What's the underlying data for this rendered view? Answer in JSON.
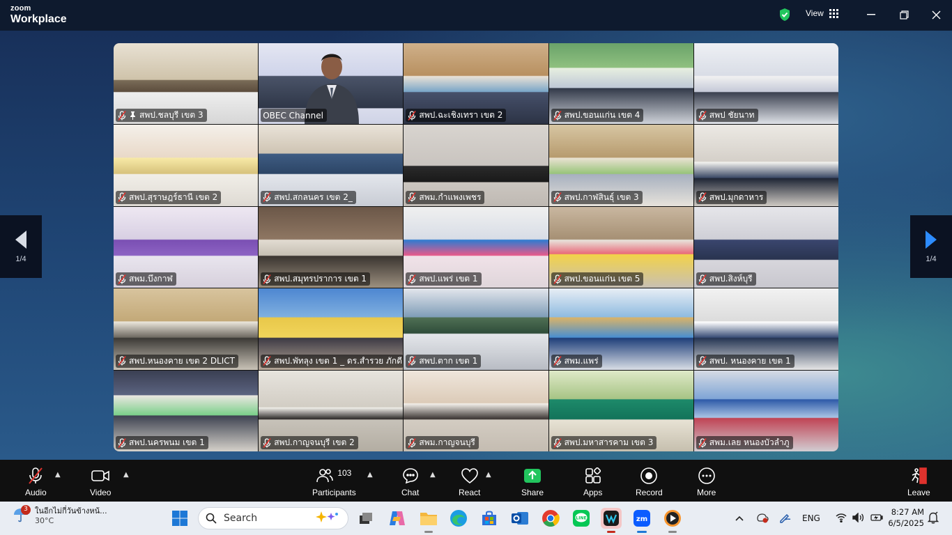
{
  "titlebar": {
    "logo_top": "zoom",
    "logo_bottom": "Workplace",
    "view_label": "View"
  },
  "pager": {
    "left": "1/4",
    "right": "1/4"
  },
  "tiles": [
    {
      "name": "สพป.ชลบุรี เขต 3",
      "pinned": true,
      "active": false
    },
    {
      "name": "OBEC Channel",
      "pinned": false,
      "active": true
    },
    {
      "name": "สพป.ฉะเชิงเทรา เขต 2",
      "pinned": false,
      "active": false
    },
    {
      "name": "สพป.ขอนแก่น เขต 4",
      "pinned": false,
      "active": false
    },
    {
      "name": "สพป ชัยนาท",
      "pinned": false,
      "active": false
    },
    {
      "name": "สพป.สุราษฎร์ธานี เขต 2",
      "pinned": false,
      "active": false
    },
    {
      "name": "สพป.สกลนคร เขต 2_",
      "pinned": false,
      "active": false
    },
    {
      "name": "สพม.กำแพงเพชร",
      "pinned": false,
      "active": false
    },
    {
      "name": "สพป.กาฬสินธุ์ เขต 3",
      "pinned": false,
      "active": false
    },
    {
      "name": "สพป.มุกดาหาร",
      "pinned": false,
      "active": false
    },
    {
      "name": "สพม.บึงกาฬ",
      "pinned": false,
      "active": false
    },
    {
      "name": "สพป.สมุทรปราการ เขต 1",
      "pinned": false,
      "active": false
    },
    {
      "name": "สพป.แพร่ เขต 1",
      "pinned": false,
      "active": false
    },
    {
      "name": "สพป.ขอนแก่น เขต 5",
      "pinned": false,
      "active": false
    },
    {
      "name": "สพป.สิงห์บุรี",
      "pinned": false,
      "active": false
    },
    {
      "name": "สพป.หนองคาย เขต 2 DLICT",
      "pinned": false,
      "active": false
    },
    {
      "name": "สพป.พัทลุง เขต 1 _ ดร.สำรวย ภักดี",
      "pinned": false,
      "active": false
    },
    {
      "name": "สพป.ตาก เขต 1",
      "pinned": false,
      "active": false
    },
    {
      "name": "สพม.แพร่",
      "pinned": false,
      "active": false
    },
    {
      "name": "สพป. หนองคาย เขต 1",
      "pinned": false,
      "active": false
    },
    {
      "name": "สพป.นครพนม เขต 1",
      "pinned": false,
      "active": false
    },
    {
      "name": "สพป.กาญจนบุรี เขต 2",
      "pinned": false,
      "active": false
    },
    {
      "name": "สพม.กาญจนบุรี",
      "pinned": false,
      "active": false
    },
    {
      "name": "สพป.มหาสารคาม เขต 3",
      "pinned": false,
      "active": false
    },
    {
      "name": "สพม.เลย หนองบัวลำภู",
      "pinned": false,
      "active": false
    }
  ],
  "toolbar": {
    "audio": "Audio",
    "video": "Video",
    "participants": "Participants",
    "participants_count": "103",
    "chat": "Chat",
    "react": "React",
    "share": "Share",
    "apps": "Apps",
    "record": "Record",
    "more": "More",
    "leave": "Leave"
  },
  "taskbar": {
    "weather_badge": "3",
    "weather_text": "ในอีกไม่กี่วันข้างหน้...",
    "weather_temp": "30°C",
    "search_label": "Search",
    "language": "ENG",
    "time": "8:27 AM",
    "date": "6/5/2025"
  },
  "colors": {
    "active_border": "#2ee59d",
    "share_green": "#22c55e",
    "mute_red": "#e0322d",
    "title_bg": "#0e1a2e",
    "toolbar_bg": "#101010"
  }
}
